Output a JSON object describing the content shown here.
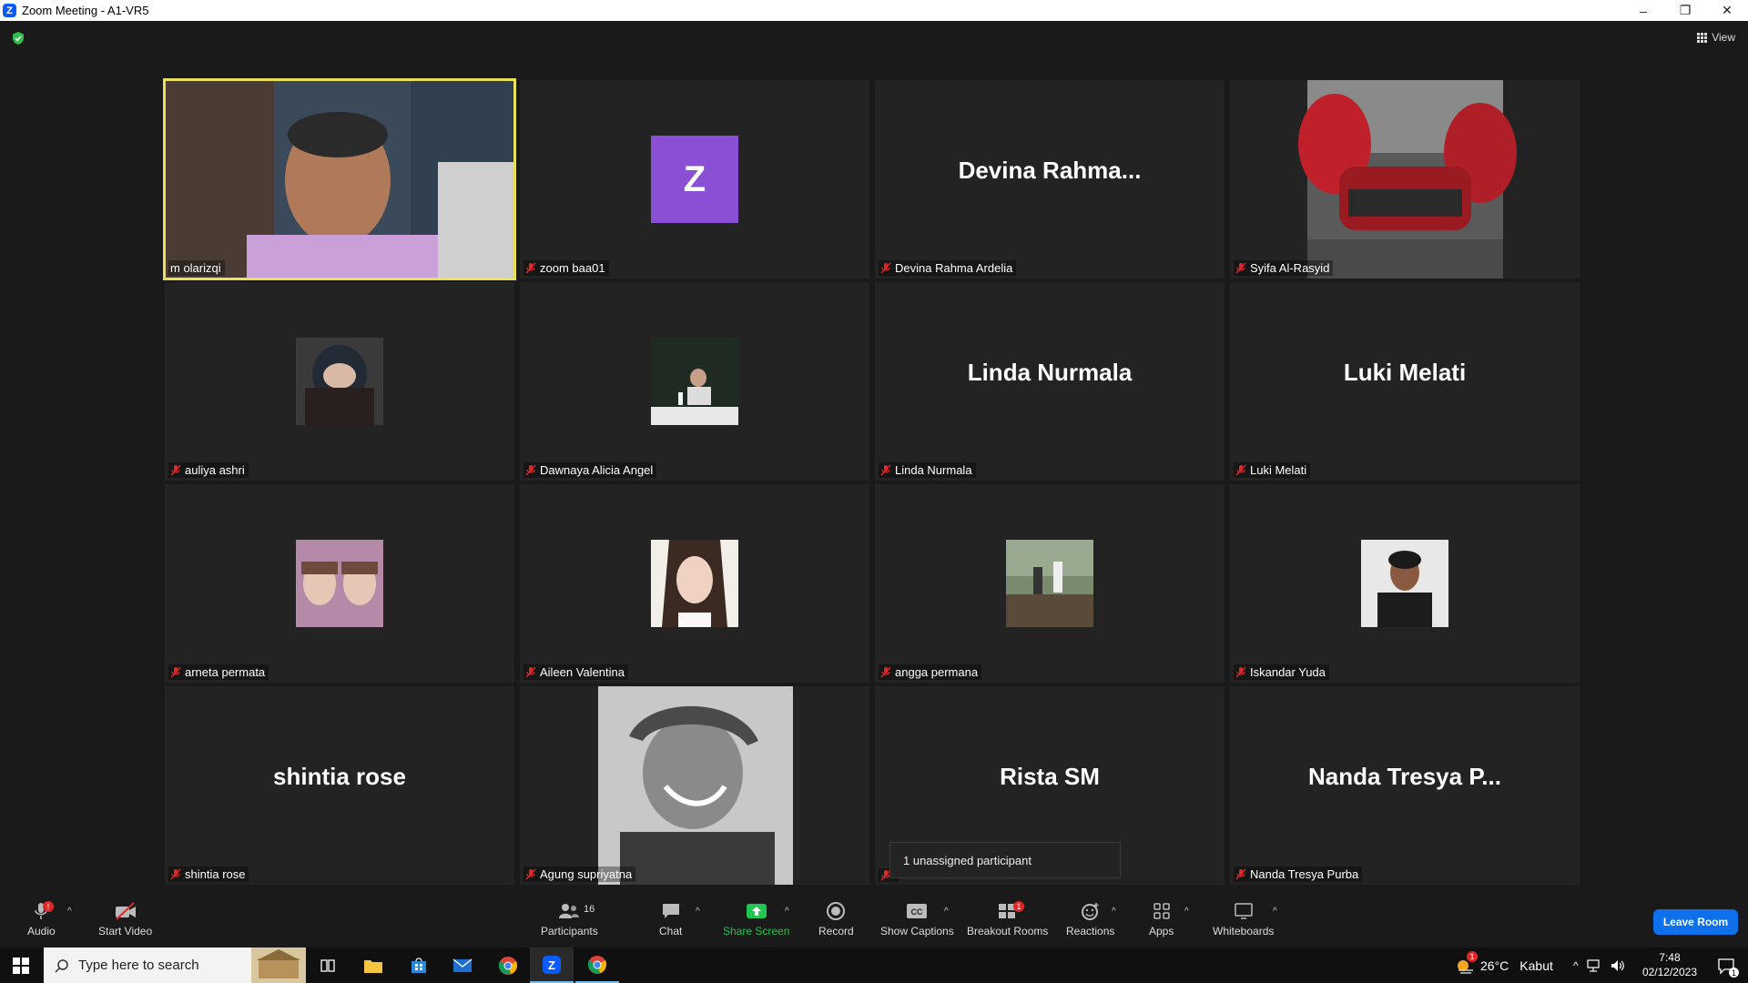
{
  "window": {
    "title": "Zoom Meeting - A1-VR5",
    "minimize": "–",
    "restore": "❐",
    "close": "✕"
  },
  "meeting": {
    "view_label": "View",
    "unassigned_popup": "1 unassigned participant"
  },
  "tiles": [
    {
      "name": "m olarizqi"
    },
    {
      "name": "zoom baa01",
      "initial": "Z"
    },
    {
      "name": "Devina Rahma Ardelia",
      "display": "Devina  Rahma..."
    },
    {
      "name": "Syifa Al-Rasyid"
    },
    {
      "name": "auliya ashri"
    },
    {
      "name": "Dawnaya Alicia Angel"
    },
    {
      "name": "Linda Nurmala",
      "display": "Linda Nurmala"
    },
    {
      "name": "Luki Melati",
      "display": "Luki Melati"
    },
    {
      "name": "arneta permata"
    },
    {
      "name": "Aileen Valentina"
    },
    {
      "name": "angga permana"
    },
    {
      "name": "Iskandar Yuda"
    },
    {
      "name": "shintia rose",
      "display": "shintia rose"
    },
    {
      "name": "Agung supriyatna"
    },
    {
      "name": "",
      "display": "Rista SM"
    },
    {
      "name": "Nanda Tresya Purba",
      "display": "Nanda Tresya P..."
    }
  ],
  "toolbar": {
    "audio": "Audio",
    "audio_badge": "!",
    "start_video": "Start Video",
    "participants": "Participants",
    "participants_count": "16",
    "chat": "Chat",
    "share_screen": "Share Screen",
    "record": "Record",
    "show_captions": "Show Captions",
    "breakout_rooms": "Breakout Rooms",
    "breakout_badge": "1",
    "reactions": "Reactions",
    "apps": "Apps",
    "whiteboards": "Whiteboards",
    "leave_room": "Leave Room"
  },
  "taskbar": {
    "search_placeholder": "Type here to search",
    "weather_temp": "26°C",
    "weather_desc": "Kabut",
    "weather_badge": "1",
    "time": "7:48",
    "date": "02/12/2023",
    "notification_count": "1"
  },
  "colors": {
    "active_speaker": "#e9e05a",
    "leave_button": "#0e71eb",
    "share_green": "#23c552",
    "avatar_purple": "#8b4fd6"
  }
}
